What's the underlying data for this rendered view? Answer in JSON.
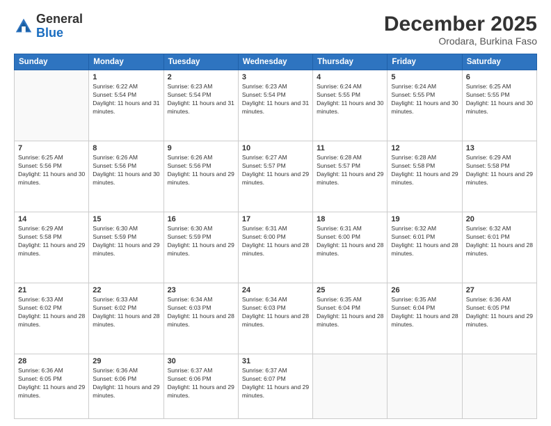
{
  "logo": {
    "general": "General",
    "blue": "Blue"
  },
  "header": {
    "month": "December 2025",
    "location": "Orodara, Burkina Faso"
  },
  "weekdays": [
    "Sunday",
    "Monday",
    "Tuesday",
    "Wednesday",
    "Thursday",
    "Friday",
    "Saturday"
  ],
  "weeks": [
    [
      {
        "day": "",
        "sunrise": "",
        "sunset": "",
        "daylight": ""
      },
      {
        "day": "1",
        "sunrise": "Sunrise: 6:22 AM",
        "sunset": "Sunset: 5:54 PM",
        "daylight": "Daylight: 11 hours and 31 minutes."
      },
      {
        "day": "2",
        "sunrise": "Sunrise: 6:23 AM",
        "sunset": "Sunset: 5:54 PM",
        "daylight": "Daylight: 11 hours and 31 minutes."
      },
      {
        "day": "3",
        "sunrise": "Sunrise: 6:23 AM",
        "sunset": "Sunset: 5:54 PM",
        "daylight": "Daylight: 11 hours and 31 minutes."
      },
      {
        "day": "4",
        "sunrise": "Sunrise: 6:24 AM",
        "sunset": "Sunset: 5:55 PM",
        "daylight": "Daylight: 11 hours and 30 minutes."
      },
      {
        "day": "5",
        "sunrise": "Sunrise: 6:24 AM",
        "sunset": "Sunset: 5:55 PM",
        "daylight": "Daylight: 11 hours and 30 minutes."
      },
      {
        "day": "6",
        "sunrise": "Sunrise: 6:25 AM",
        "sunset": "Sunset: 5:55 PM",
        "daylight": "Daylight: 11 hours and 30 minutes."
      }
    ],
    [
      {
        "day": "7",
        "sunrise": "Sunrise: 6:25 AM",
        "sunset": "Sunset: 5:56 PM",
        "daylight": "Daylight: 11 hours and 30 minutes."
      },
      {
        "day": "8",
        "sunrise": "Sunrise: 6:26 AM",
        "sunset": "Sunset: 5:56 PM",
        "daylight": "Daylight: 11 hours and 30 minutes."
      },
      {
        "day": "9",
        "sunrise": "Sunrise: 6:26 AM",
        "sunset": "Sunset: 5:56 PM",
        "daylight": "Daylight: 11 hours and 29 minutes."
      },
      {
        "day": "10",
        "sunrise": "Sunrise: 6:27 AM",
        "sunset": "Sunset: 5:57 PM",
        "daylight": "Daylight: 11 hours and 29 minutes."
      },
      {
        "day": "11",
        "sunrise": "Sunrise: 6:28 AM",
        "sunset": "Sunset: 5:57 PM",
        "daylight": "Daylight: 11 hours and 29 minutes."
      },
      {
        "day": "12",
        "sunrise": "Sunrise: 6:28 AM",
        "sunset": "Sunset: 5:58 PM",
        "daylight": "Daylight: 11 hours and 29 minutes."
      },
      {
        "day": "13",
        "sunrise": "Sunrise: 6:29 AM",
        "sunset": "Sunset: 5:58 PM",
        "daylight": "Daylight: 11 hours and 29 minutes."
      }
    ],
    [
      {
        "day": "14",
        "sunrise": "Sunrise: 6:29 AM",
        "sunset": "Sunset: 5:58 PM",
        "daylight": "Daylight: 11 hours and 29 minutes."
      },
      {
        "day": "15",
        "sunrise": "Sunrise: 6:30 AM",
        "sunset": "Sunset: 5:59 PM",
        "daylight": "Daylight: 11 hours and 29 minutes."
      },
      {
        "day": "16",
        "sunrise": "Sunrise: 6:30 AM",
        "sunset": "Sunset: 5:59 PM",
        "daylight": "Daylight: 11 hours and 29 minutes."
      },
      {
        "day": "17",
        "sunrise": "Sunrise: 6:31 AM",
        "sunset": "Sunset: 6:00 PM",
        "daylight": "Daylight: 11 hours and 28 minutes."
      },
      {
        "day": "18",
        "sunrise": "Sunrise: 6:31 AM",
        "sunset": "Sunset: 6:00 PM",
        "daylight": "Daylight: 11 hours and 28 minutes."
      },
      {
        "day": "19",
        "sunrise": "Sunrise: 6:32 AM",
        "sunset": "Sunset: 6:01 PM",
        "daylight": "Daylight: 11 hours and 28 minutes."
      },
      {
        "day": "20",
        "sunrise": "Sunrise: 6:32 AM",
        "sunset": "Sunset: 6:01 PM",
        "daylight": "Daylight: 11 hours and 28 minutes."
      }
    ],
    [
      {
        "day": "21",
        "sunrise": "Sunrise: 6:33 AM",
        "sunset": "Sunset: 6:02 PM",
        "daylight": "Daylight: 11 hours and 28 minutes."
      },
      {
        "day": "22",
        "sunrise": "Sunrise: 6:33 AM",
        "sunset": "Sunset: 6:02 PM",
        "daylight": "Daylight: 11 hours and 28 minutes."
      },
      {
        "day": "23",
        "sunrise": "Sunrise: 6:34 AM",
        "sunset": "Sunset: 6:03 PM",
        "daylight": "Daylight: 11 hours and 28 minutes."
      },
      {
        "day": "24",
        "sunrise": "Sunrise: 6:34 AM",
        "sunset": "Sunset: 6:03 PM",
        "daylight": "Daylight: 11 hours and 28 minutes."
      },
      {
        "day": "25",
        "sunrise": "Sunrise: 6:35 AM",
        "sunset": "Sunset: 6:04 PM",
        "daylight": "Daylight: 11 hours and 28 minutes."
      },
      {
        "day": "26",
        "sunrise": "Sunrise: 6:35 AM",
        "sunset": "Sunset: 6:04 PM",
        "daylight": "Daylight: 11 hours and 28 minutes."
      },
      {
        "day": "27",
        "sunrise": "Sunrise: 6:36 AM",
        "sunset": "Sunset: 6:05 PM",
        "daylight": "Daylight: 11 hours and 29 minutes."
      }
    ],
    [
      {
        "day": "28",
        "sunrise": "Sunrise: 6:36 AM",
        "sunset": "Sunset: 6:05 PM",
        "daylight": "Daylight: 11 hours and 29 minutes."
      },
      {
        "day": "29",
        "sunrise": "Sunrise: 6:36 AM",
        "sunset": "Sunset: 6:06 PM",
        "daylight": "Daylight: 11 hours and 29 minutes."
      },
      {
        "day": "30",
        "sunrise": "Sunrise: 6:37 AM",
        "sunset": "Sunset: 6:06 PM",
        "daylight": "Daylight: 11 hours and 29 minutes."
      },
      {
        "day": "31",
        "sunrise": "Sunrise: 6:37 AM",
        "sunset": "Sunset: 6:07 PM",
        "daylight": "Daylight: 11 hours and 29 minutes."
      },
      {
        "day": "",
        "sunrise": "",
        "sunset": "",
        "daylight": ""
      },
      {
        "day": "",
        "sunrise": "",
        "sunset": "",
        "daylight": ""
      },
      {
        "day": "",
        "sunrise": "",
        "sunset": "",
        "daylight": ""
      }
    ]
  ]
}
